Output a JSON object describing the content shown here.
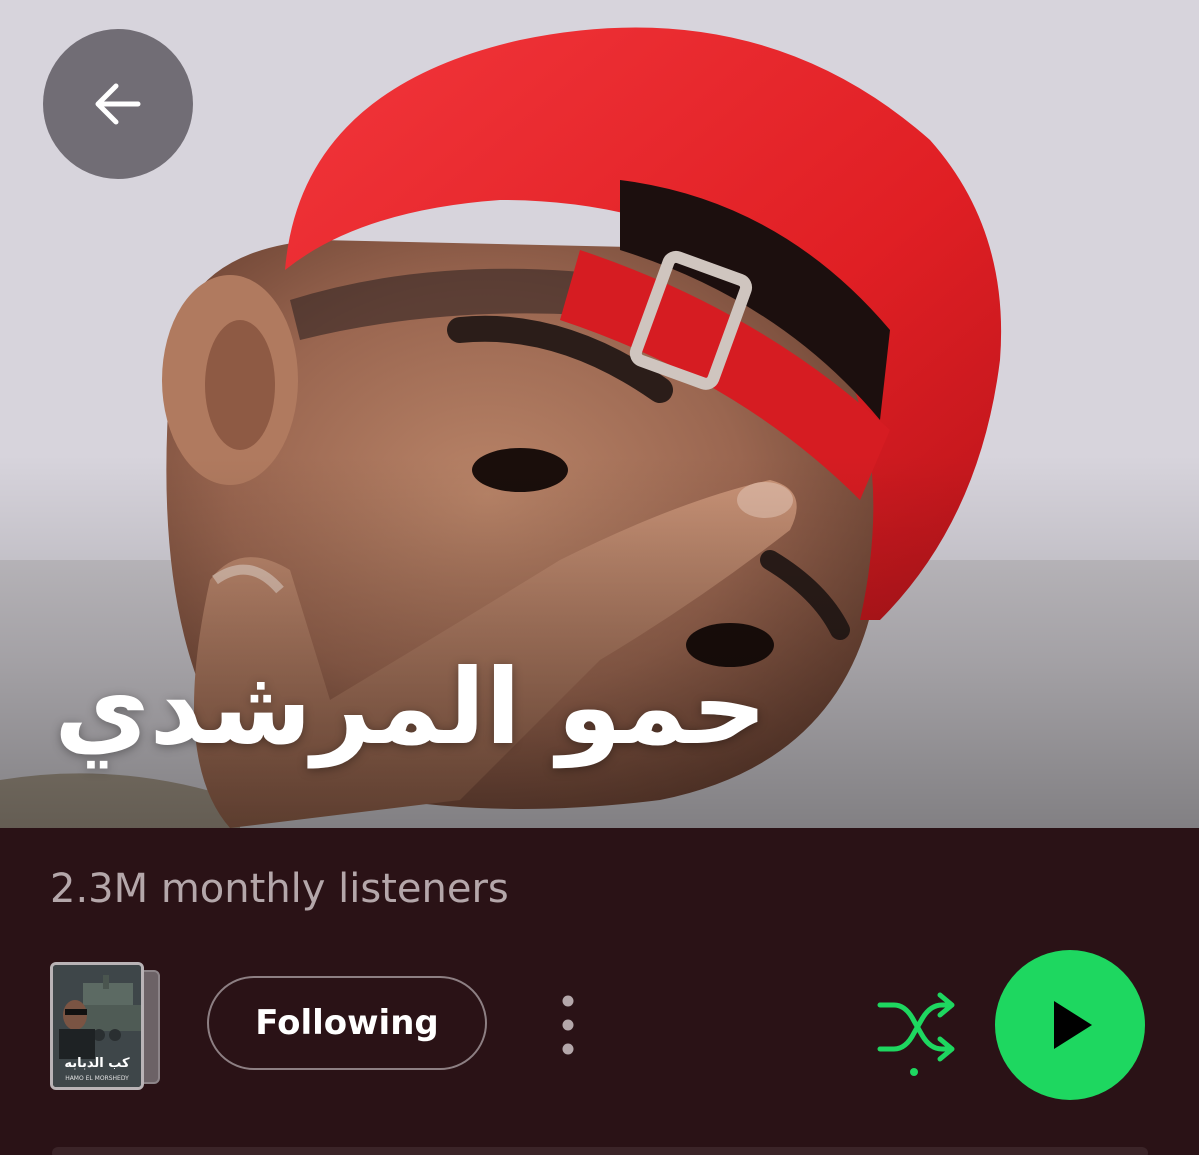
{
  "artist": {
    "name": "حمو المرشدي",
    "monthly_listeners": "2.3M monthly listeners"
  },
  "header": {
    "back_icon": "arrow-left-icon"
  },
  "actions": {
    "following_label": "Following",
    "more_icon": "more-vertical-icon",
    "shuffle_icon": "shuffle-icon",
    "play_icon": "play-icon"
  },
  "latest_release": {
    "title": "كب الدبابه",
    "subtitle": "HAMO EL MORSHEDY"
  },
  "colors": {
    "background": "#2a1216",
    "accent_green": "#1ed760",
    "subtext": "#b4a7aa",
    "cap_red": "#e52227"
  }
}
